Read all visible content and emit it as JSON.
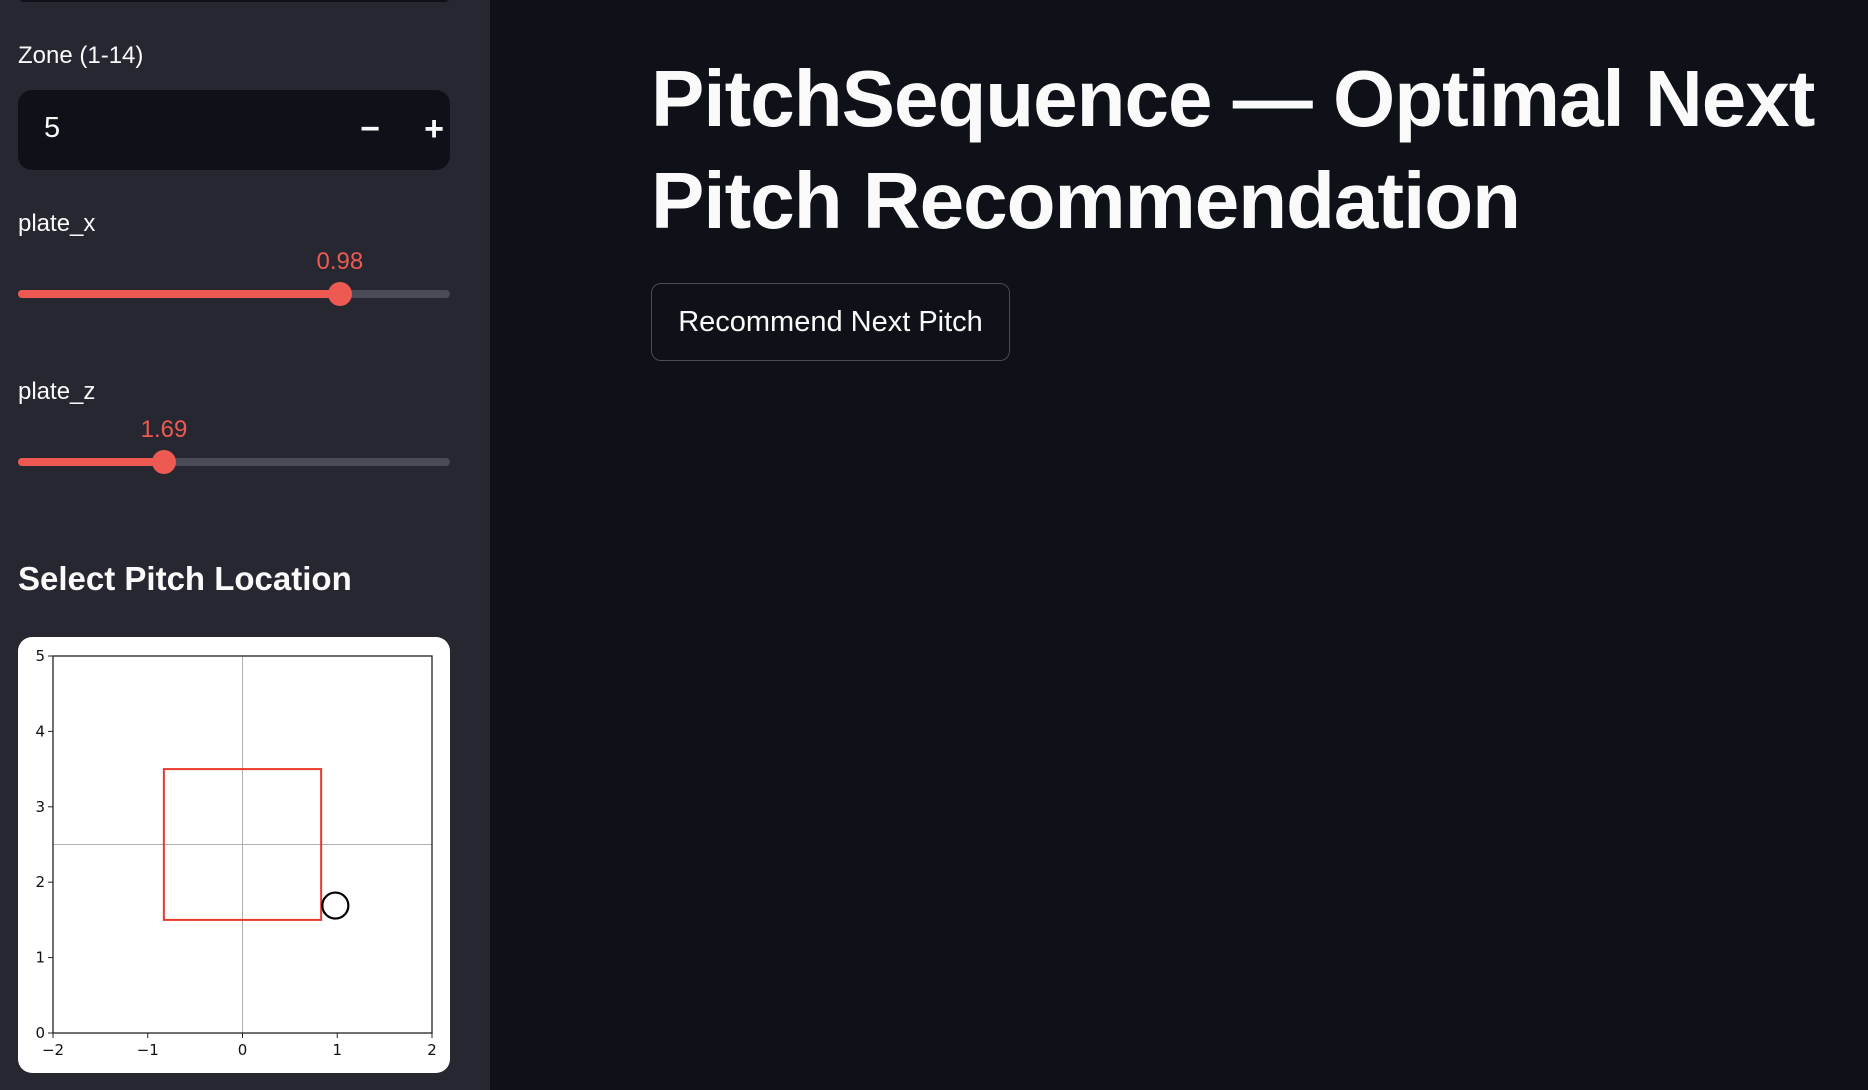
{
  "sidebar": {
    "zone": {
      "label": "Zone (1-14)",
      "value": "5",
      "decrement": "−",
      "increment": "+"
    },
    "plate_x": {
      "label": "plate_x",
      "value": 0.98,
      "value_text": "0.98",
      "min": -2,
      "max": 2
    },
    "plate_z": {
      "label": "plate_z",
      "value": 1.69,
      "value_text": "1.69",
      "min": 0,
      "max": 5
    },
    "section_title": "Select Pitch Location"
  },
  "main": {
    "title": "PitchSequence — Optimal Next Pitch Recommendation",
    "button": "Recommend Next Pitch"
  },
  "chart_data": {
    "type": "scatter",
    "xlim": [
      -2,
      2
    ],
    "ylim": [
      0,
      5
    ],
    "xticks": [
      "−2",
      "−1",
      "0",
      "1",
      "2"
    ],
    "xtick_values": [
      -2,
      -1,
      0,
      1,
      2
    ],
    "yticks": [
      "0",
      "1",
      "2",
      "3",
      "4",
      "5"
    ],
    "ytick_values": [
      0,
      1,
      2,
      3,
      4,
      5
    ],
    "reference_lines": {
      "x": 0,
      "y": 2.5
    },
    "strike_zone": {
      "x": [
        -0.83,
        0.83
      ],
      "z": [
        1.5,
        3.5
      ],
      "color": "#e8392c"
    },
    "point": {
      "x": 0.98,
      "z": 1.69
    }
  }
}
